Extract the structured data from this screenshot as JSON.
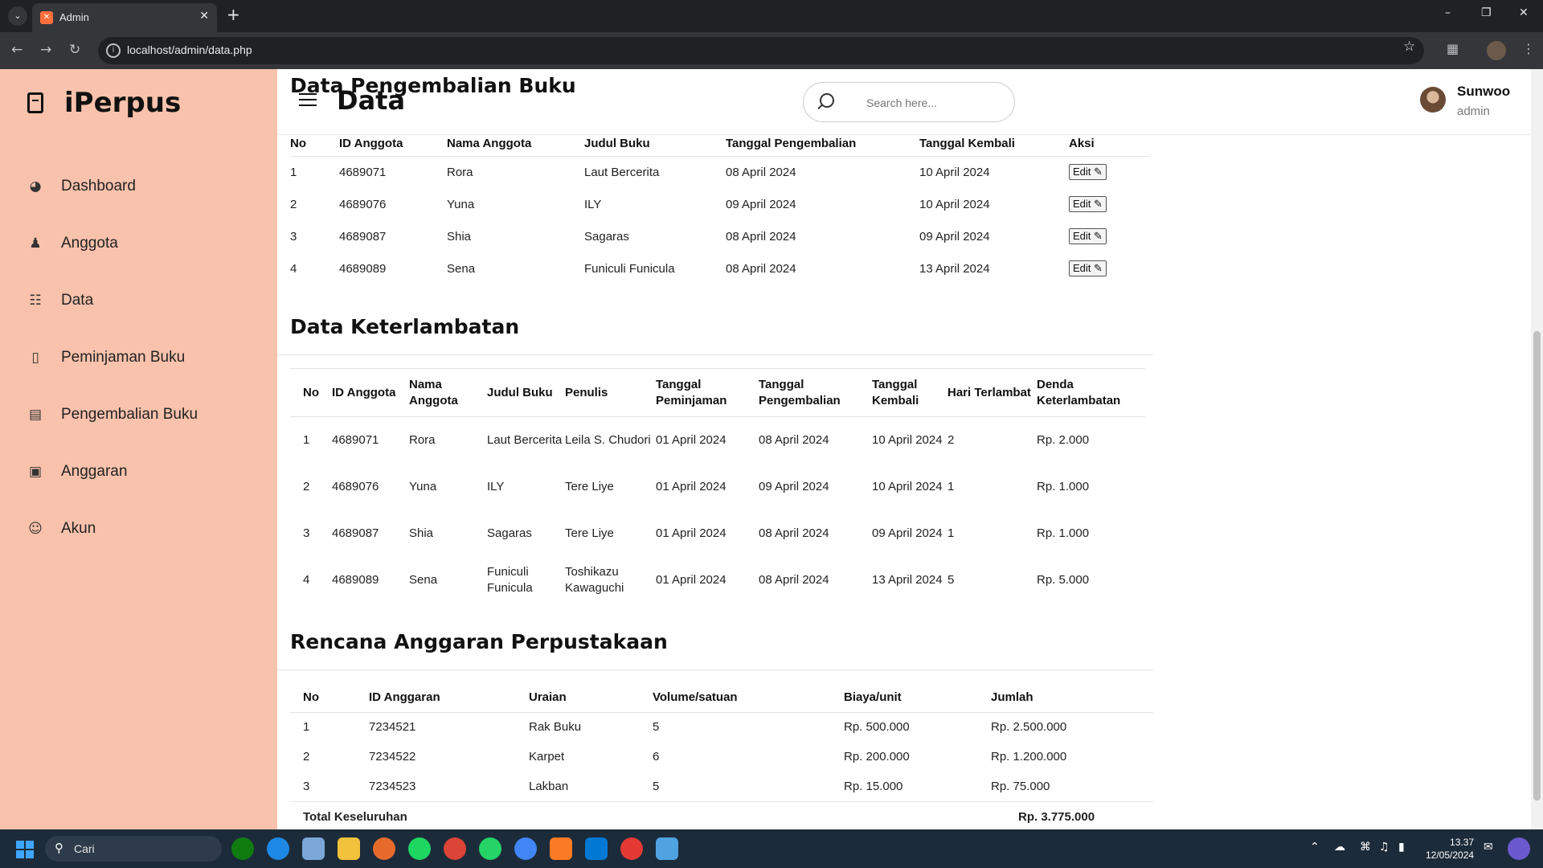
{
  "browser": {
    "tab_title": "Admin",
    "url": "localhost/admin/data.php"
  },
  "sidebar": {
    "brand": "iPerpus",
    "items": [
      {
        "label": "Dashboard",
        "icon": "dashboard-icon"
      },
      {
        "label": "Anggota",
        "icon": "users-icon"
      },
      {
        "label": "Data",
        "icon": "clipboard-icon"
      },
      {
        "label": "Peminjaman Buku",
        "icon": "book-icon"
      },
      {
        "label": "Pengembalian Buku",
        "icon": "printer-icon"
      },
      {
        "label": "Anggaran",
        "icon": "wallet-icon"
      },
      {
        "label": "Akun",
        "icon": "user-circle-icon"
      }
    ]
  },
  "header": {
    "title": "Data",
    "search_placeholder": "Search here...",
    "user_name": "Sunwoo",
    "user_role": "admin"
  },
  "pengembalian": {
    "title": "Data Pengembalian Buku",
    "headers": [
      "No",
      "ID Anggota",
      "Nama Anggota",
      "Judul Buku",
      "Tanggal Pengembalian",
      "Tanggal Kembali",
      "Aksi"
    ],
    "edit_label": "Edit",
    "rows": [
      [
        "1",
        "4689071",
        "Rora",
        "Laut Bercerita",
        "08 April 2024",
        "10 April 2024"
      ],
      [
        "2",
        "4689076",
        "Yuna",
        "ILY",
        "09 April 2024",
        "10 April 2024"
      ],
      [
        "3",
        "4689087",
        "Shia",
        "Sagaras",
        "08 April 2024",
        "09 April 2024"
      ],
      [
        "4",
        "4689089",
        "Sena",
        "Funiculi Funicula",
        "08 April 2024",
        "13 April 2024"
      ]
    ]
  },
  "keterlambatan": {
    "title": "Data Keterlambatan",
    "headers": [
      "No",
      "ID Anggota",
      "Nama Anggota",
      "Judul Buku",
      "Penulis",
      "Tanggal Peminjaman",
      "Tanggal Pengembalian",
      "Tanggal Kembali",
      "Hari Terlambat",
      "Denda Keterlambatan"
    ],
    "rows": [
      [
        "1",
        "4689071",
        "Rora",
        "Laut Bercerita",
        "Leila S. Chudori",
        "01 April 2024",
        "08 April 2024",
        "10 April 2024",
        "2",
        "Rp. 2.000"
      ],
      [
        "2",
        "4689076",
        "Yuna",
        "ILY",
        "Tere Liye",
        "01 April 2024",
        "09 April 2024",
        "10 April 2024",
        "1",
        "Rp. 1.000"
      ],
      [
        "3",
        "4689087",
        "Shia",
        "Sagaras",
        "Tere Liye",
        "01 April 2024",
        "08 April 2024",
        "09 April 2024",
        "1",
        "Rp. 1.000"
      ],
      [
        "4",
        "4689089",
        "Sena",
        "Funiculi Funicula",
        "Toshikazu Kawaguchi",
        "01 April 2024",
        "08 April 2024",
        "13 April 2024",
        "5",
        "Rp. 5.000"
      ]
    ]
  },
  "anggaran": {
    "title": "Rencana Anggaran Perpustakaan",
    "headers": [
      "No",
      "ID Anggaran",
      "Uraian",
      "Volume/satuan",
      "Biaya/unit",
      "Jumlah"
    ],
    "rows": [
      [
        "1",
        "7234521",
        "Rak Buku",
        "5",
        "Rp. 500.000",
        "Rp. 2.500.000"
      ],
      [
        "2",
        "7234522",
        "Karpet",
        "6",
        "Rp. 200.000",
        "Rp. 1.200.000"
      ],
      [
        "3",
        "7234523",
        "Lakban",
        "5",
        "Rp. 15.000",
        "Rp. 75.000"
      ]
    ],
    "total_label": "Total Keseluruhan",
    "total_value": "Rp. 3.775.000"
  },
  "taskbar": {
    "search_label": "Cari",
    "time": "13.37",
    "date": "12/05/2024"
  }
}
